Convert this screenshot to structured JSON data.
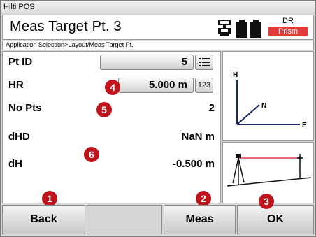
{
  "window": {
    "title": "Hilti POS"
  },
  "header": {
    "title": "Meas Target Pt. 3",
    "mode_label": "DR",
    "target_badge": "Prism",
    "icons": [
      "total-station-icon",
      "battery-icon"
    ],
    "badge_color": "#e03a3a"
  },
  "breadcrumb": "Application Selection>Layout/Meas Target Pt.",
  "fields": {
    "pt_id": {
      "label": "Pt ID",
      "value": "5",
      "button_icon": "list-icon"
    },
    "hr": {
      "label": "HR",
      "value": "5.000 m",
      "button_label": "123"
    },
    "no_pts": {
      "label": "No Pts",
      "value": "2"
    },
    "dhd": {
      "label": "dHD",
      "value": "NaN m"
    },
    "dh": {
      "label": "dH",
      "value": "-0.500 m"
    }
  },
  "axes_graphic": {
    "h_label": "H",
    "n_label": "N",
    "e_label": "E"
  },
  "markers": [
    "1",
    "2",
    "3",
    "4",
    "5",
    "6"
  ],
  "marker_color": "#c0141c",
  "softkeys": {
    "back": "Back",
    "meas": "Meas",
    "ok": "OK"
  }
}
